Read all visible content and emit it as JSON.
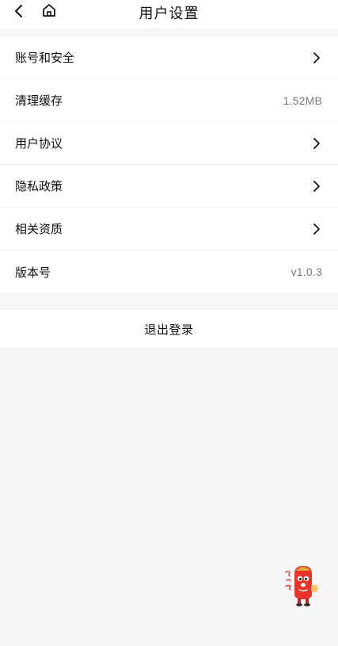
{
  "nav": {
    "title": "用户设置",
    "back_icon": "chevron-left-icon",
    "home_icon": "home-icon"
  },
  "settings": {
    "items": [
      {
        "label": "账号和安全",
        "value": "",
        "icon": "chevron-right-icon"
      },
      {
        "label": "清理缓存",
        "value": "1.52MB",
        "icon": ""
      },
      {
        "label": "用户协议",
        "value": "",
        "icon": "chevron-right-icon"
      },
      {
        "label": "隐私政策",
        "value": "",
        "icon": "chevron-right-icon"
      },
      {
        "label": "相关资质",
        "value": "",
        "icon": "chevron-right-icon"
      },
      {
        "label": "版本号",
        "value": "v1.0.3",
        "icon": ""
      }
    ]
  },
  "logout": {
    "label": "退出登录"
  },
  "mascot": {
    "icon": "mascot-icon"
  },
  "colors": {
    "background": "#f6f6f6",
    "card": "#ffffff",
    "text": "#111111",
    "secondary_text": "#777777",
    "mascot_red": "#e8322a"
  }
}
